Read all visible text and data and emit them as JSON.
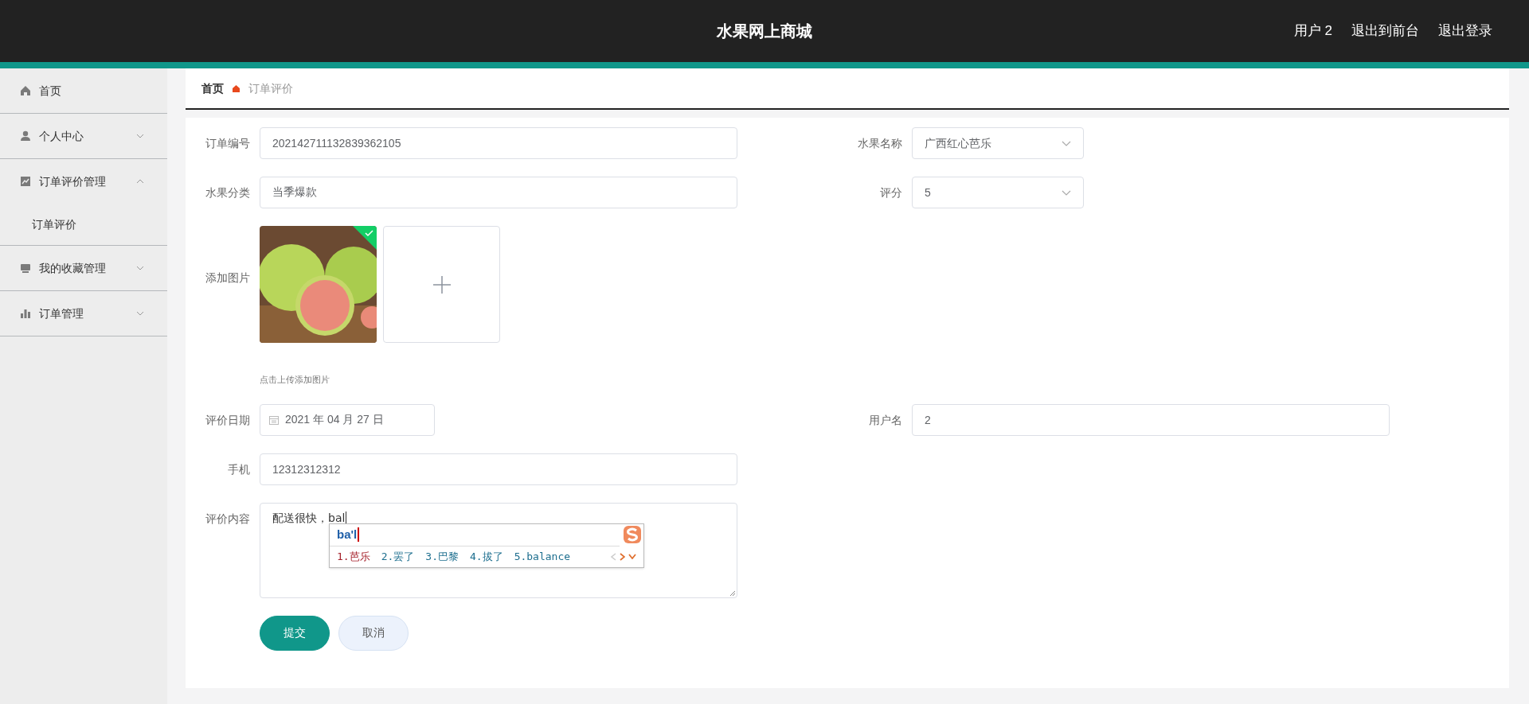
{
  "header": {
    "title": "水果网上商城",
    "links": [
      "用户 2",
      "退出到前台",
      "退出登录"
    ]
  },
  "sidebar": {
    "items": [
      {
        "label": "首页"
      },
      {
        "label": "个人中心",
        "expanded": false
      },
      {
        "label": "订单评价管理",
        "expanded": true,
        "children": [
          {
            "label": "订单评价"
          }
        ]
      },
      {
        "label": "我的收藏管理",
        "expanded": false
      },
      {
        "label": "订单管理",
        "expanded": false
      }
    ]
  },
  "breadcrumb": {
    "items": [
      "首页",
      "订单评价"
    ]
  },
  "form": {
    "rows": [
      [
        {
          "kind": "text",
          "label": "订单编号",
          "value": "202142711132839362105"
        },
        {
          "kind": "select",
          "label": "水果名称",
          "value": "广西红心芭乐"
        }
      ],
      [
        {
          "kind": "text",
          "label": "水果分类",
          "value": "当季爆款"
        },
        {
          "kind": "select",
          "label": "评分",
          "value": "5"
        }
      ],
      [
        {
          "kind": "image_upload",
          "label": "添加图片",
          "hint": "点击上传添加图片"
        }
      ],
      [
        {
          "kind": "date",
          "label": "评价日期",
          "value": "2021 年 04 月 27 日"
        },
        {
          "kind": "text",
          "label": "用户名",
          "value": "2"
        }
      ],
      [
        {
          "kind": "text",
          "label": "手机",
          "value": "12312312312"
        }
      ],
      [
        {
          "kind": "textarea",
          "label": "评价内容",
          "value": "配送很快，bal"
        }
      ]
    ],
    "buttons": [
      {
        "kind": "primary",
        "label": "提交"
      },
      {
        "kind": "secondary",
        "label": "取消"
      }
    ]
  },
  "ime_popup": {
    "composition": "ba'l",
    "candidates": [
      {
        "label": "1.芭乐",
        "selected": true
      },
      {
        "label": "2.罢了",
        "selected": false
      },
      {
        "label": "3.巴黎",
        "selected": false
      },
      {
        "label": "4.拔了",
        "selected": false
      },
      {
        "label": "5.balance",
        "selected": false
      }
    ]
  }
}
